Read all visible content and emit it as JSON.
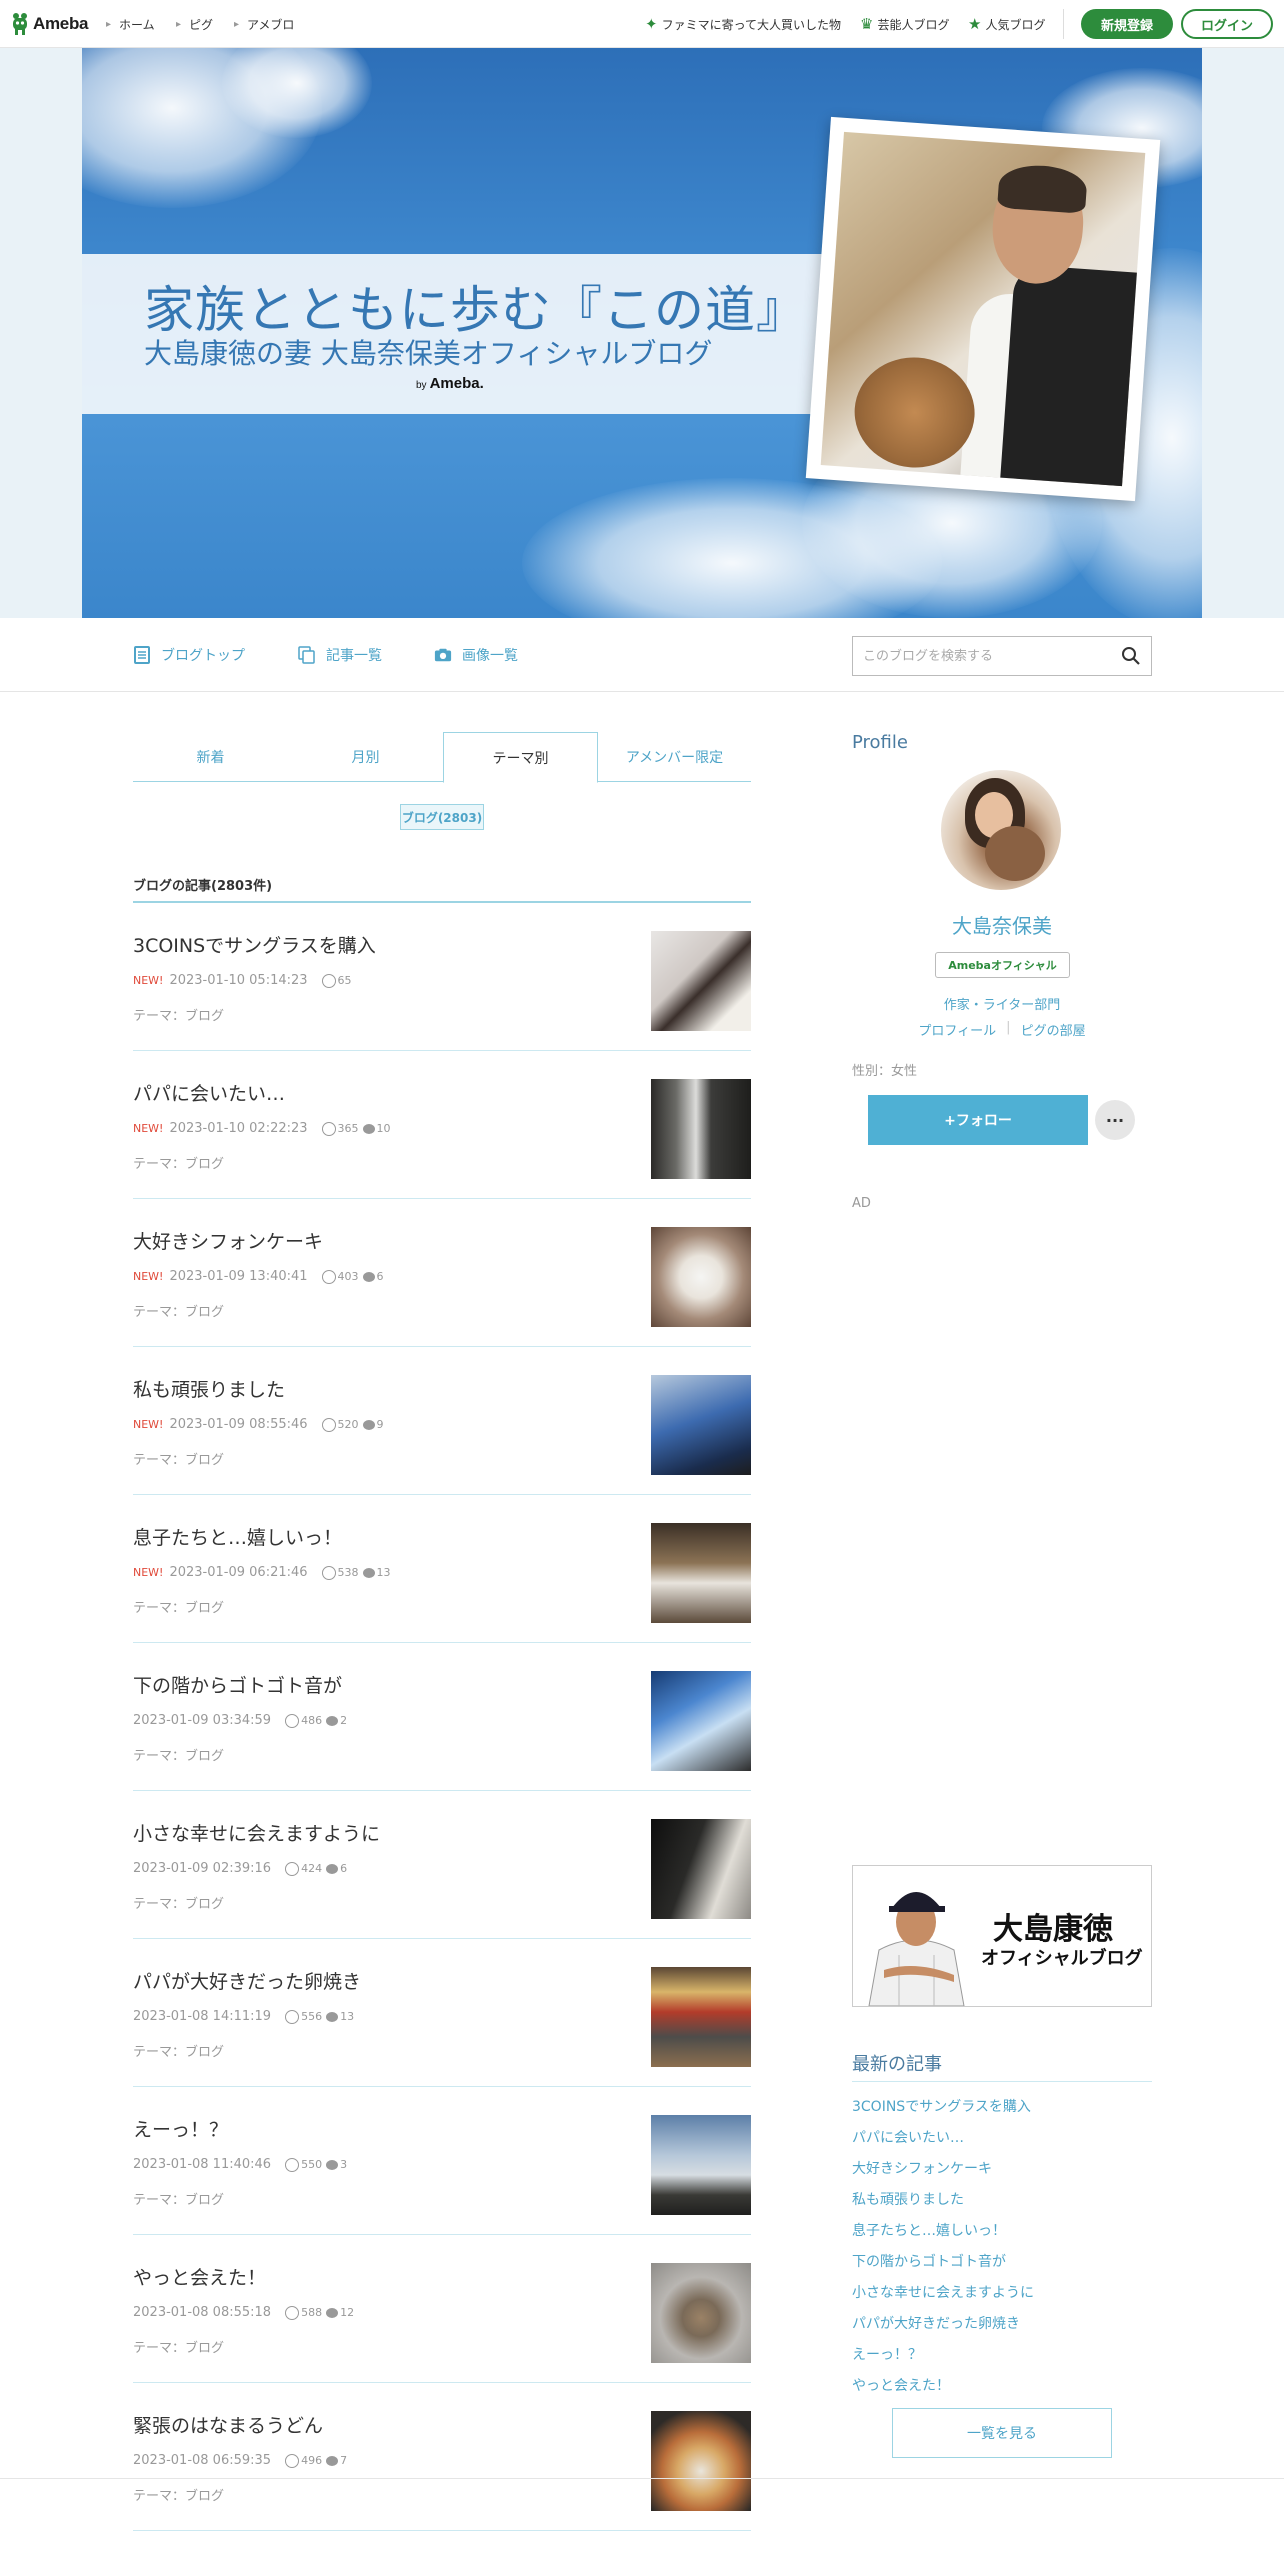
{
  "topbar": {
    "brand": "Ameba",
    "nav": [
      "ホーム",
      "ピグ",
      "アメブロ"
    ],
    "links": [
      "ファミマに寄って大人買いした物",
      "芸能人ブログ",
      "人気ブログ"
    ],
    "register": "新規登録",
    "login": "ログイン",
    "accent": "#2d8c3c"
  },
  "hero": {
    "title": "家族とともに歩む『この道』",
    "subtitle": "大島康徳の妻 大島奈保美オフィシャルブログ",
    "by": "by",
    "by_brand": "Ameba."
  },
  "subnav": {
    "items": [
      {
        "label": "ブログトップ",
        "icon": "document-icon"
      },
      {
        "label": "記事一覧",
        "icon": "copy-icon"
      },
      {
        "label": "画像一覧",
        "icon": "camera-icon"
      }
    ],
    "search_placeholder": "このブログを検索する"
  },
  "tabs": [
    "新着",
    "月別",
    "テーマ別",
    "アメンバー限定"
  ],
  "active_tab": "テーマ別",
  "theme_pill": "ブログ(2803)",
  "list_heading": "ブログの記事(2803件)",
  "theme_label": "テーマ：ブログ",
  "new_label": "NEW!",
  "articles": [
    {
      "title": "3COINSでサングラスを購入",
      "new": true,
      "date": "2023-01-10 05:14:23",
      "likes": "65",
      "comments": ""
    },
    {
      "title": "パパに会いたい…",
      "new": true,
      "date": "2023-01-10 02:22:23",
      "likes": "365",
      "comments": "10"
    },
    {
      "title": "大好きシフォンケーキ",
      "new": true,
      "date": "2023-01-09 13:40:41",
      "likes": "403",
      "comments": "6"
    },
    {
      "title": "私も頑張りました",
      "new": true,
      "date": "2023-01-09 08:55:46",
      "likes": "520",
      "comments": "9"
    },
    {
      "title": "息子たちと…嬉しいっ！",
      "new": true,
      "date": "2023-01-09 06:21:46",
      "likes": "538",
      "comments": "13"
    },
    {
      "title": "下の階からゴトゴト音が",
      "new": false,
      "date": "2023-01-09 03:34:59",
      "likes": "486",
      "comments": "2"
    },
    {
      "title": "小さな幸せに会えますように",
      "new": false,
      "date": "2023-01-09 02:39:16",
      "likes": "424",
      "comments": "6"
    },
    {
      "title": "パパが大好きだった卵焼き",
      "new": false,
      "date": "2023-01-08 14:11:19",
      "likes": "556",
      "comments": "13"
    },
    {
      "title": "えーっ！？",
      "new": false,
      "date": "2023-01-08 11:40:46",
      "likes": "550",
      "comments": "3"
    },
    {
      "title": "やっと会えた！",
      "new": false,
      "date": "2023-01-08 08:55:18",
      "likes": "588",
      "comments": "12"
    },
    {
      "title": "緊張のはなまるうどん",
      "new": false,
      "date": "2023-01-08 06:59:35",
      "likes": "496",
      "comments": "7"
    }
  ],
  "profile": {
    "heading": "Profile",
    "name": "大島奈保美",
    "badge": "Amebaオフィシャル",
    "category": "作家・ライター部門",
    "link1": "プロフィール",
    "link2": "ピグの部屋",
    "gender": "性別：女性",
    "follow": "+フォロー",
    "more": "···",
    "ad": "AD"
  },
  "banner": {
    "line1": "大島康徳",
    "line2": "オフィシャルブログ"
  },
  "recent": {
    "heading": "最新の記事",
    "items": [
      "3COINSでサングラスを購入",
      "パパに会いたい…",
      "大好きシフォンケーキ",
      "私も頑張りました",
      "息子たちと…嬉しいっ！",
      "下の階からゴトゴト音が",
      "小さな幸せに会えますように",
      "パパが大好きだった卵焼き",
      "えーっ！？",
      "やっと会えた！"
    ],
    "see_all": "一覧を見る"
  },
  "colors": {
    "link": "#4ea4c8",
    "follow": "#4fb0d4",
    "new": "#e04a3a"
  }
}
